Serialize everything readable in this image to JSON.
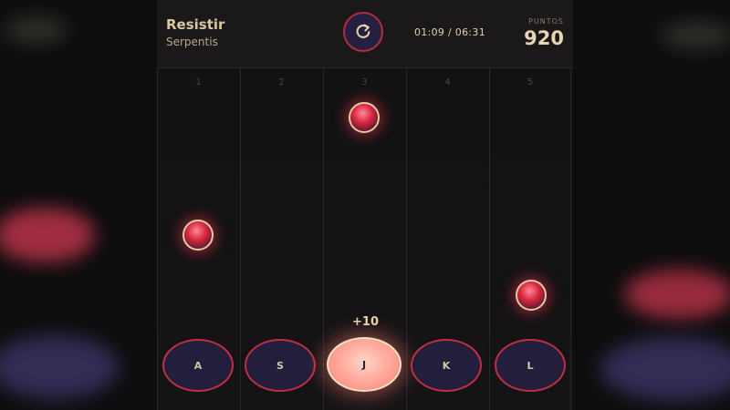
{
  "song": {
    "title": "Resistir",
    "artist": "Serpentis"
  },
  "controls": {
    "restart_icon": "restart-icon"
  },
  "timer": {
    "current": "01:09",
    "total": "06:31",
    "display": "01:09 / 06:31"
  },
  "score": {
    "label": "PUNTOS",
    "value": "920"
  },
  "lanes": [
    {
      "number": "1",
      "key": "A",
      "active": false
    },
    {
      "number": "2",
      "key": "S",
      "active": false
    },
    {
      "number": "3",
      "key": "J",
      "active": true
    },
    {
      "number": "4",
      "key": "K",
      "active": false
    },
    {
      "number": "5",
      "key": "L",
      "active": false
    }
  ],
  "hit_feedback": "+10",
  "colors": {
    "accent": "#c22e45",
    "key_fill": "#221e3b",
    "text": "#e8d6b2"
  }
}
